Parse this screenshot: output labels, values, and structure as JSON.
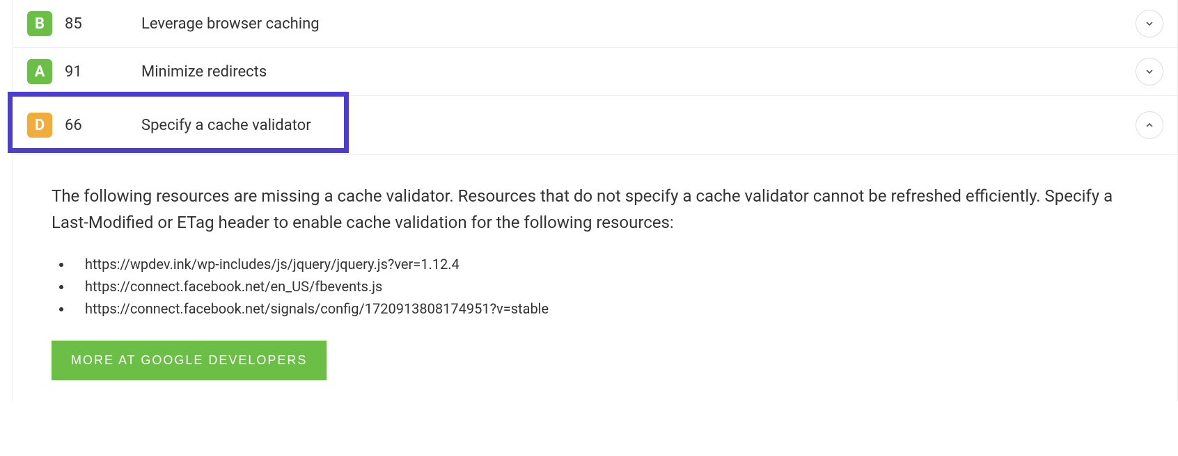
{
  "rules": [
    {
      "grade": "B",
      "score": "85",
      "title": "Leverage browser caching",
      "expanded": false,
      "highlighted": false
    },
    {
      "grade": "A",
      "score": "91",
      "title": "Minimize redirects",
      "expanded": false,
      "highlighted": false
    },
    {
      "grade": "D",
      "score": "66",
      "title": "Specify a cache validator",
      "expanded": true,
      "highlighted": true
    }
  ],
  "details": {
    "description": "The following resources are missing a cache validator. Resources that do not specify a cache validator cannot be refreshed efficiently. Specify a Last-Modified or ETag header to enable cache validation for the following resources:",
    "resources": [
      "https://wpdev.ink/wp-includes/js/jquery/jquery.js?ver=1.12.4",
      "https://connect.facebook.net/en_US/fbevents.js",
      "https://connect.facebook.net/signals/config/1720913808174951?v=stable"
    ],
    "more_button_label": "MORE AT GOOGLE DEVELOPERS"
  }
}
